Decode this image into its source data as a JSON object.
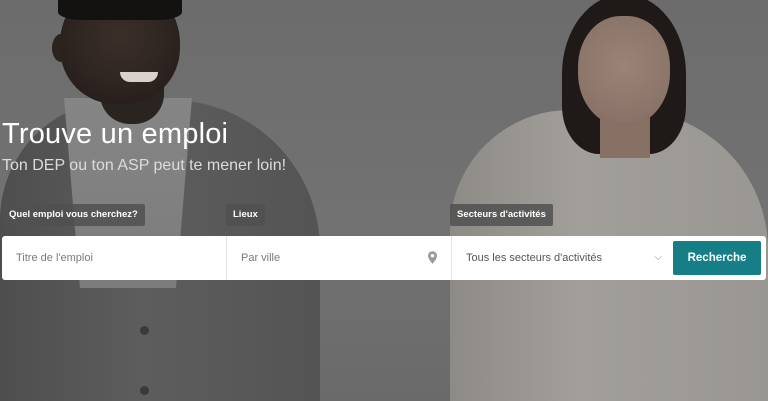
{
  "hero": {
    "title": "Trouve un emploi",
    "subtitle": "Ton DEP ou ton ASP peut te mener loin!"
  },
  "search": {
    "job_label": "Quel emploi vous cherchez?",
    "job_placeholder": "Titre de l'emploi",
    "location_label": "Lieux",
    "location_placeholder": "Par ville",
    "location_icon": "map-pin-icon",
    "sector_label": "Secteurs d'activités",
    "sector_selected": "Tous les secteurs d'activités",
    "sector_icon": "chevron-down-icon",
    "button_label": "Recherche"
  },
  "colors": {
    "accent": "#157e86",
    "overlay": "#707070"
  }
}
